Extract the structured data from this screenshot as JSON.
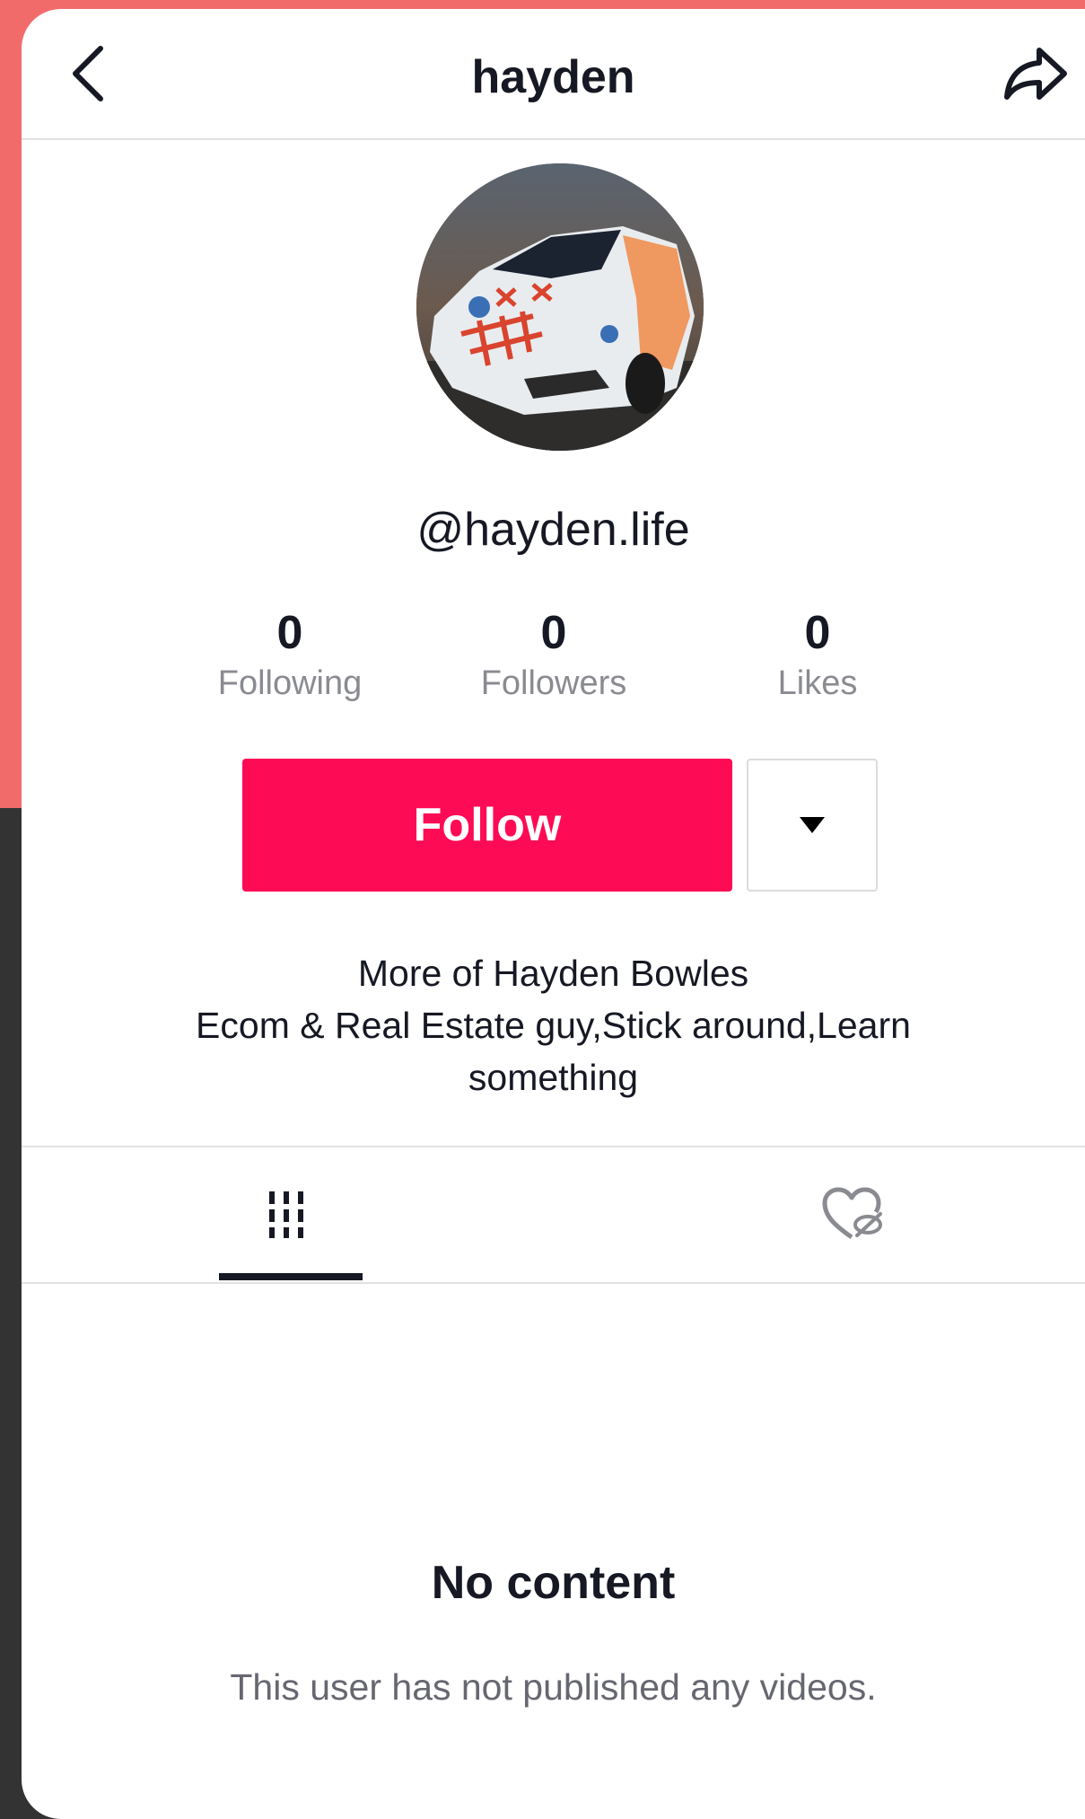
{
  "header": {
    "title": "hayden",
    "back_icon": "chevron-left-icon",
    "share_icon": "share-arrow-icon"
  },
  "profile": {
    "avatar": "car-photo-avatar",
    "username": "@hayden.life"
  },
  "stats": [
    {
      "value": "0",
      "label": "Following"
    },
    {
      "value": "0",
      "label": "Followers"
    },
    {
      "value": "0",
      "label": "Likes"
    }
  ],
  "actions": {
    "follow_label": "Follow",
    "follow_color": "#fe0b55",
    "dropdown_icon": "caret-down-icon"
  },
  "bio": {
    "line1": "More of Hayden Bowles",
    "line2": "Ecom & Real Estate guy,Stick around,Learn something"
  },
  "tabs": [
    {
      "icon": "videos-grid-icon",
      "active": true
    },
    {
      "icon": "liked-hidden-icon",
      "active": false
    }
  ],
  "empty_state": {
    "title": "No content",
    "subtitle": "This user has not published any videos."
  },
  "colors": {
    "background_top": "#f26b6b",
    "background_bottom": "#333333",
    "text_primary": "#161823",
    "text_secondary": "#8a8b91"
  }
}
